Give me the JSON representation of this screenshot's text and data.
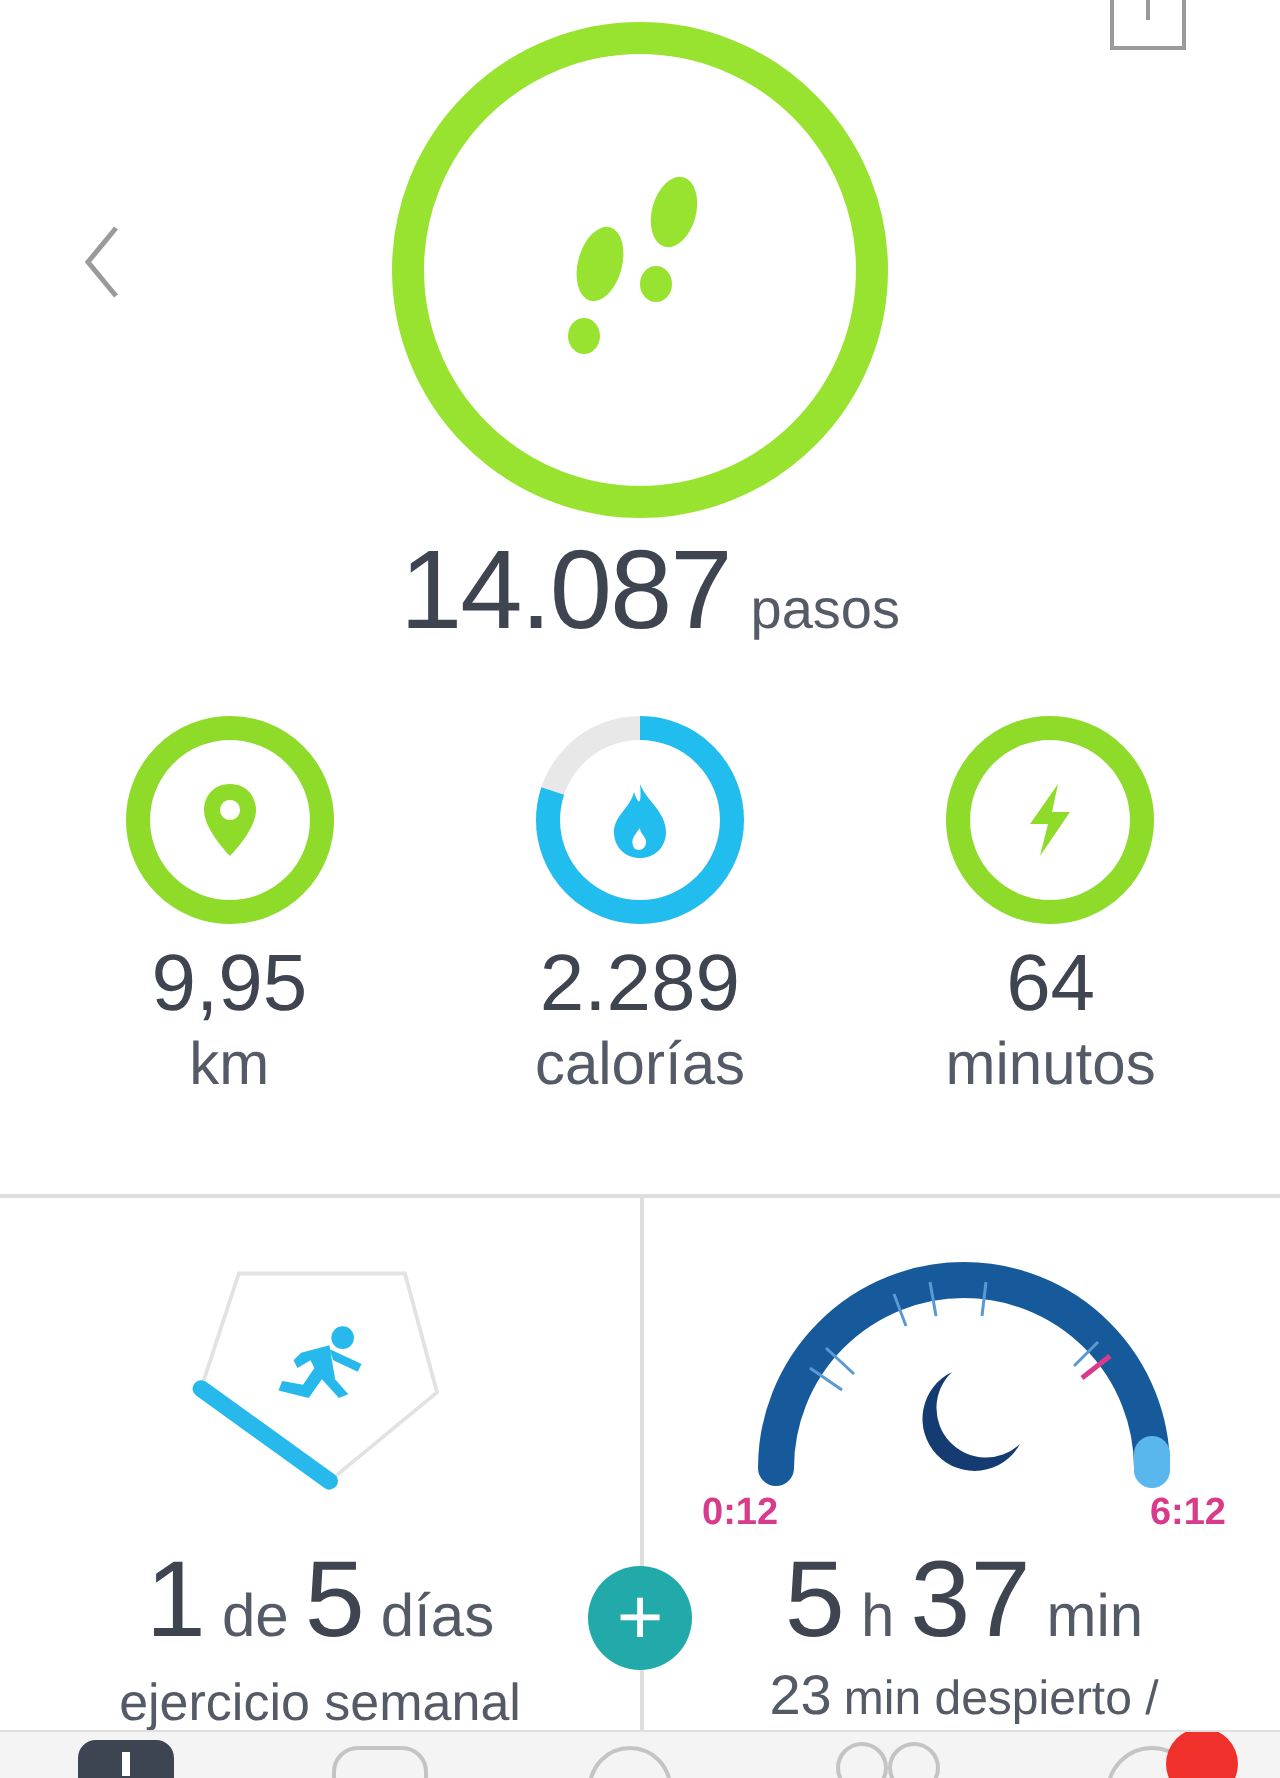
{
  "steps": {
    "value": "14.087",
    "unit": "pasos"
  },
  "stats": [
    {
      "kind": "distance",
      "value": "9,95",
      "unit": "km",
      "color": "#8fdb2a"
    },
    {
      "kind": "calories",
      "value": "2.289",
      "unit": "calorías",
      "color": "#22bdef"
    },
    {
      "kind": "minutes",
      "value": "64",
      "unit": "minutos",
      "color": "#8fdb2a"
    }
  ],
  "exercise": {
    "days": "1",
    "of": "de",
    "goal": "5",
    "unit": "días",
    "label": "ejercicio semanal"
  },
  "add": {
    "symbol": "+"
  },
  "sleep": {
    "start": "0:12",
    "end": "6:12",
    "hours": "5",
    "hours_unit": "h",
    "minutes": "37",
    "minutes_unit": "min",
    "awake": "23",
    "awake_text": "min despierto /"
  },
  "tabs": [
    {
      "kind": "dashboard",
      "selected": true,
      "badge": false
    },
    {
      "kind": "challenges",
      "selected": false,
      "badge": false
    },
    {
      "kind": "guidance",
      "selected": false,
      "badge": false
    },
    {
      "kind": "community",
      "selected": false,
      "badge": false
    },
    {
      "kind": "notifications",
      "selected": false,
      "badge": true
    }
  ]
}
